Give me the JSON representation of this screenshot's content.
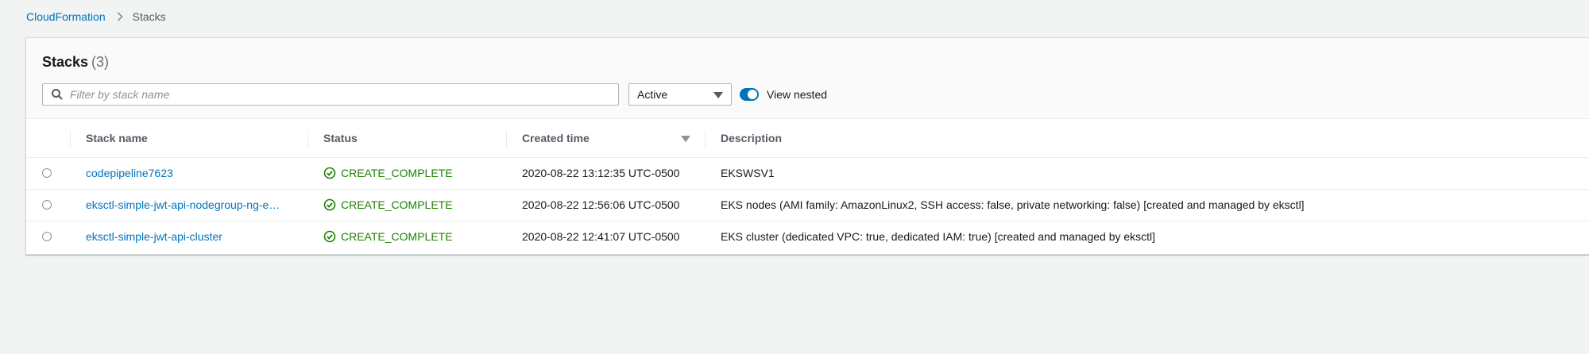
{
  "breadcrumb": {
    "root": "CloudFormation",
    "current": "Stacks"
  },
  "panel": {
    "title": "Stacks",
    "count": "(3)"
  },
  "filter": {
    "placeholder": "Filter by stack name",
    "status_select": "Active",
    "view_nested_label": "View nested",
    "view_nested_on": true
  },
  "table": {
    "columns": {
      "name": "Stack name",
      "status": "Status",
      "created": "Created time",
      "description": "Description"
    },
    "rows": [
      {
        "name": "codepipeline7623",
        "status": "CREATE_COMPLETE",
        "created": "2020-08-22 13:12:35 UTC-0500",
        "description": "EKSWSV1"
      },
      {
        "name": "eksctl-simple-jwt-api-nodegroup-ng-e…",
        "status": "CREATE_COMPLETE",
        "created": "2020-08-22 12:56:06 UTC-0500",
        "description": "EKS nodes (AMI family: AmazonLinux2, SSH access: false, private networking: false) [created and managed by eksctl]"
      },
      {
        "name": "eksctl-simple-jwt-api-cluster",
        "status": "CREATE_COMPLETE",
        "created": "2020-08-22 12:41:07 UTC-0500",
        "description": "EKS cluster (dedicated VPC: true, dedicated IAM: true) [created and managed by eksctl]"
      }
    ]
  },
  "colors": {
    "link": "#0073bb",
    "success": "#1d8102",
    "background": "#f2f3f3"
  },
  "icons": {
    "breadcrumb_separator": "chevron-right-icon",
    "search": "search-icon",
    "dropdown": "caret-down-icon",
    "sort": "sort-descending-icon",
    "status": "check-circle-icon"
  }
}
